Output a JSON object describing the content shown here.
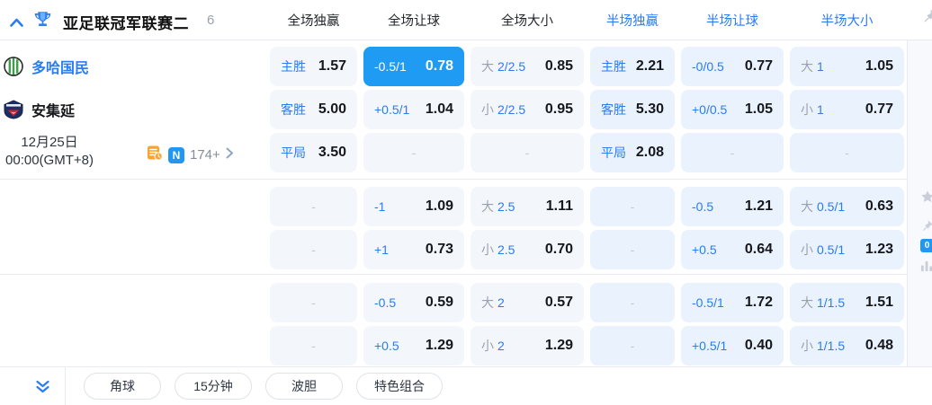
{
  "colors": {
    "accent": "#2b7cf0",
    "selected": "#1f9bf3",
    "cell-bg": "#f3f6fa",
    "cell-bg-half": "#e9f2fd"
  },
  "header": {
    "league_title": "亚足联冠军联赛二",
    "match_count": "6",
    "columns": [
      {
        "label": "全场独赢"
      },
      {
        "label": "全场让球"
      },
      {
        "label": "全场大小"
      },
      {
        "label": "半场独赢"
      },
      {
        "label": "半场让球"
      },
      {
        "label": "半场大小"
      }
    ]
  },
  "match": {
    "home_team": "多哈国民",
    "away_team": "安集延",
    "date": "12月25日",
    "time": "00:00(GMT+8)",
    "n_badge": "N",
    "extra_markets": "174+"
  },
  "odds": {
    "groups": [
      {
        "rows": [
          {
            "cells": [
              {
                "lab": "主胜",
                "val": "1.57"
              },
              {
                "lab": "-0.5/1",
                "val": "0.78",
                "sel": true
              },
              {
                "pre": "大",
                "lab": "2/2.5",
                "val": "0.85"
              },
              {
                "lab": "主胜",
                "val": "2.21"
              },
              {
                "lab": "-0/0.5",
                "val": "0.77"
              },
              {
                "pre": "大",
                "lab": "1",
                "val": "1.05"
              }
            ]
          },
          {
            "cells": [
              {
                "lab": "客胜",
                "val": "5.00"
              },
              {
                "lab": "+0.5/1",
                "val": "1.04"
              },
              {
                "pre": "小",
                "lab": "2/2.5",
                "val": "0.95"
              },
              {
                "lab": "客胜",
                "val": "5.30"
              },
              {
                "lab": "+0/0.5",
                "val": "1.05"
              },
              {
                "pre": "小",
                "lab": "1",
                "val": "0.77"
              }
            ]
          },
          {
            "cells": [
              {
                "lab": "平局",
                "val": "3.50"
              },
              {
                "val": "-"
              },
              {
                "val": "-"
              },
              {
                "lab": "平局",
                "val": "2.08"
              },
              {
                "val": "-"
              },
              {
                "val": "-"
              }
            ]
          }
        ]
      },
      {
        "rows": [
          {
            "cells": [
              {
                "val": "-"
              },
              {
                "lab": "-1",
                "val": "1.09"
              },
              {
                "pre": "大",
                "lab": "2.5",
                "val": "1.11"
              },
              {
                "val": "-"
              },
              {
                "lab": "-0.5",
                "val": "1.21"
              },
              {
                "pre": "大",
                "lab": "0.5/1",
                "val": "0.63"
              }
            ]
          },
          {
            "cells": [
              {
                "val": "-"
              },
              {
                "lab": "+1",
                "val": "0.73"
              },
              {
                "pre": "小",
                "lab": "2.5",
                "val": "0.70"
              },
              {
                "val": "-"
              },
              {
                "lab": "+0.5",
                "val": "0.64"
              },
              {
                "pre": "小",
                "lab": "0.5/1",
                "val": "1.23"
              }
            ]
          }
        ]
      },
      {
        "rows": [
          {
            "cells": [
              {
                "val": "-"
              },
              {
                "lab": "-0.5",
                "val": "0.59"
              },
              {
                "pre": "大",
                "lab": "2",
                "val": "0.57"
              },
              {
                "val": "-"
              },
              {
                "lab": "-0.5/1",
                "val": "1.72"
              },
              {
                "pre": "大",
                "lab": "1/1.5",
                "val": "1.51"
              }
            ]
          },
          {
            "cells": [
              {
                "val": "-"
              },
              {
                "lab": "+0.5",
                "val": "1.29"
              },
              {
                "pre": "小",
                "lab": "2",
                "val": "1.29"
              },
              {
                "val": "-"
              },
              {
                "lab": "+0.5/1",
                "val": "0.40"
              },
              {
                "pre": "小",
                "lab": "1/1.5",
                "val": "0.48"
              }
            ]
          }
        ]
      }
    ]
  },
  "strip": {
    "badge": "0"
  },
  "footer": {
    "tabs": [
      {
        "label": "角球"
      },
      {
        "label": "15分钟"
      },
      {
        "label": "波胆"
      },
      {
        "label": "特色组合"
      }
    ]
  }
}
